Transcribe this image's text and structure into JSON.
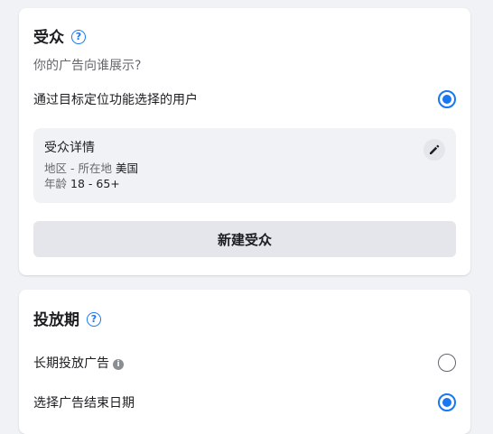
{
  "audience": {
    "title": "受众",
    "subtitle": "你的广告向谁展示?",
    "targeting_option": {
      "label": "通过目标定位功能选择的用户",
      "selected": true
    },
    "details": {
      "title": "受众详情",
      "location_label": "地区 - 所在地",
      "location_value": "美国",
      "age_label": "年龄",
      "age_value": "18 - 65+"
    },
    "new_audience_button": "新建受众"
  },
  "schedule": {
    "title": "投放期",
    "options": [
      {
        "label": "长期投放广告",
        "selected": false,
        "has_info": true
      },
      {
        "label": "选择广告结束日期",
        "selected": true,
        "has_info": false
      }
    ]
  },
  "colors": {
    "accent": "#1877f2",
    "page_background": "#f0f2f5",
    "secondary_text": "#65676b"
  },
  "icons": {
    "help": "question-circle-icon",
    "edit": "pencil-icon",
    "info": "info-circle-icon"
  }
}
